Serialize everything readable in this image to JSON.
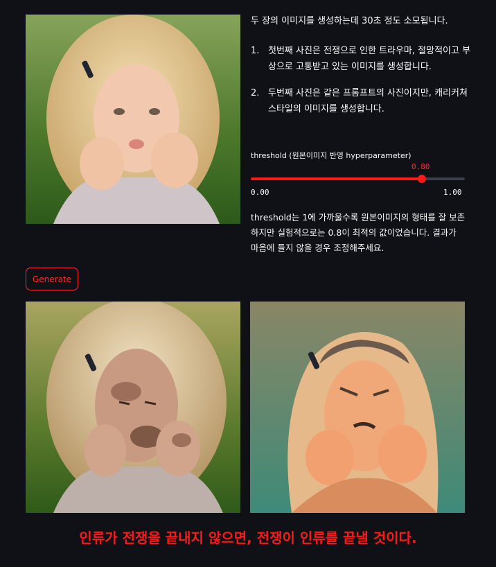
{
  "intro": "두 장의 이미지를 생성하는데 30초 정도 소모됩니다.",
  "steps": [
    {
      "num": "1.",
      "text": "첫번째 사진은 전쟁으로 인한 트라우마, 절망적이고 부상으로 고통받고 있는 이미지를 생성합니다."
    },
    {
      "num": "2.",
      "text": "두번째 사진은 같은 프롬프트의 사진이지만, 캐리커쳐 스타일의 이미지를 생성합니다."
    }
  ],
  "slider": {
    "label": "threshold (원본이미지 반영 hyperparameter)",
    "value": 0.8,
    "value_text": "0.80",
    "min": 0.0,
    "max": 1.0,
    "min_text": "0.00",
    "max_text": "1.00"
  },
  "description": "threshold는 1에 가까울수록 원본이미지의 형태를 잘 보존하지만 실험적으로는 0.8이 최적의 값이었습니다. 결과가 마음에 들지 않을 경우 조정해주세요.",
  "generate_label": "Generate",
  "quote": "인류가 전쟁을 끝내지 않으면, 전쟁이 인류를 끝낼 것이다.",
  "colors": {
    "accent": "#ff2b2b",
    "background": "#0f1116",
    "track": "#3b3f4a"
  },
  "images": [
    "child-portrait",
    "war-trauma-output",
    "caricature-output"
  ]
}
